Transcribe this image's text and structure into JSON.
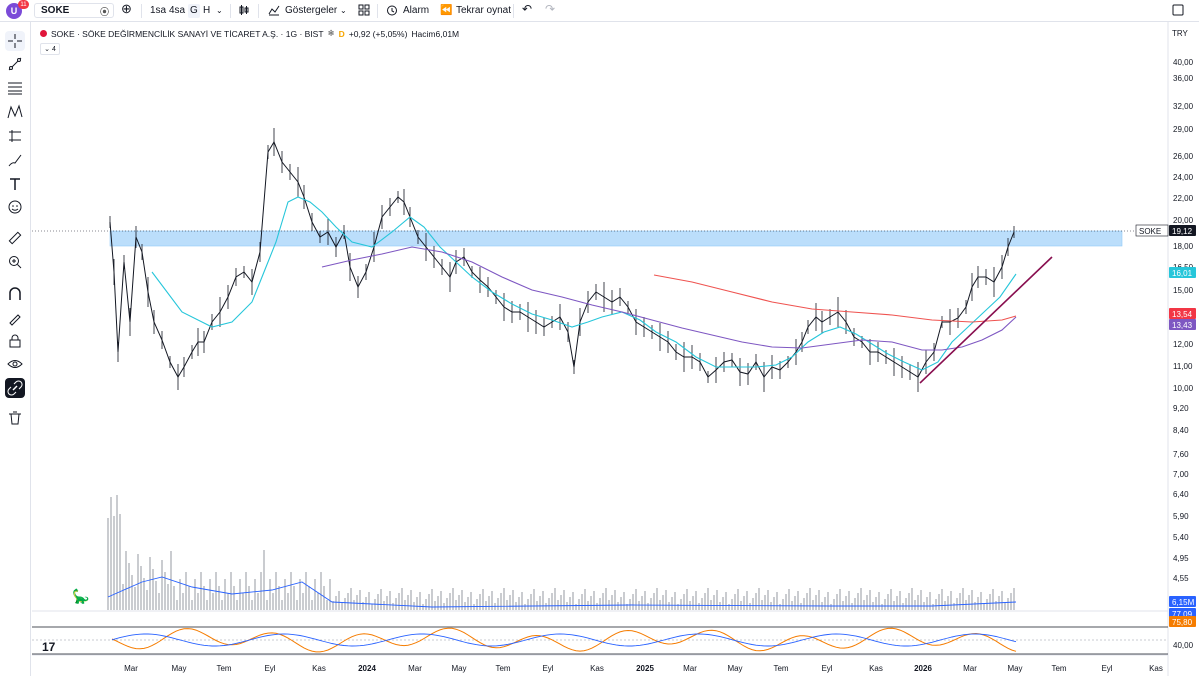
{
  "toolbar": {
    "logo_letter": "U",
    "logo_badge": "11",
    "symbol": "SOKE",
    "timeframes": [
      "1sa",
      "4sa",
      "G",
      "H"
    ],
    "active_timeframe": "G",
    "indicators_label": "Göstergeler",
    "alarm_label": "Alarm",
    "replay_label": "Tekrar oynat"
  },
  "legend": {
    "title": "SOKE · SÖKE DEĞİRMENCİLİK SANAYİ VE TİCARET A.Ş. · 1G · BIST",
    "flag": "D",
    "change": "+0,92 (+5,05%)",
    "volume": "Hacim6,01M",
    "collapse_count": "4"
  },
  "currency": "TRY",
  "price_axis": [
    "40,00",
    "36,00",
    "32,00",
    "29,00",
    "26,00",
    "24,00",
    "22,00",
    "20,00",
    "18,00",
    "16,50",
    "15,00",
    "13,50",
    "12,00",
    "11,00",
    "10,00",
    "9,20",
    "8,40",
    "7,60",
    "7,00",
    "6,40",
    "5,90",
    "5,40",
    "4,95",
    "4,55"
  ],
  "indicator_axis": [
    "40,00"
  ],
  "time_axis": [
    "Mar",
    "May",
    "Tem",
    "Eyl",
    "Kas",
    "2024",
    "Mar",
    "May",
    "Tem",
    "Eyl",
    "Kas",
    "2025",
    "Mar",
    "May",
    "Tem",
    "Eyl",
    "Kas",
    "2026",
    "Mar",
    "May",
    "Tem",
    "Eyl",
    "Kas"
  ],
  "badges": [
    {
      "label": "SOKE",
      "value": "19,12",
      "color": "#131722"
    },
    {
      "value": "16,01",
      "color": "#26c6da"
    },
    {
      "value": "13,54",
      "color": "#f23645"
    },
    {
      "value": "13,43",
      "color": "#7e57c2"
    },
    {
      "value": "6,15M",
      "color": "#2962ff"
    },
    {
      "value": "77,09",
      "color": "#2962ff"
    },
    {
      "value": "75,80",
      "color": "#f57c00"
    }
  ],
  "colors": {
    "zone": "#bbdefb",
    "ema_fast": "#26c6da",
    "ema_mid": "#7e57c2",
    "ema_slow": "#ef5350",
    "trendline": "#880e4f",
    "rsi": "#f57c00",
    "rsi_ma": "#2962ff"
  },
  "tv_logo": "17"
}
